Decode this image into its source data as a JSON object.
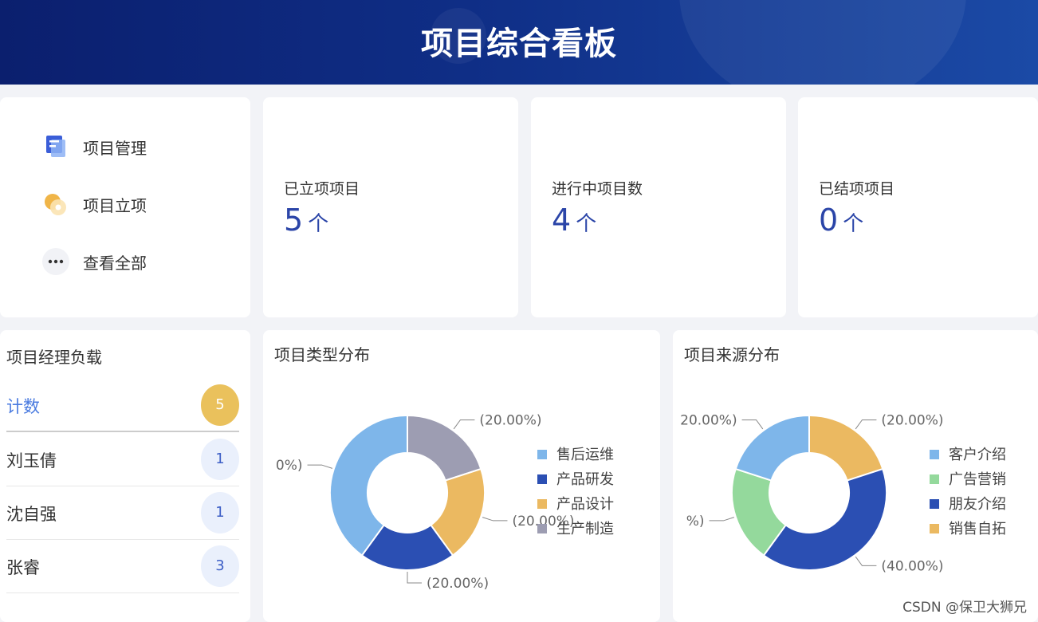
{
  "header": {
    "title": "项目综合看板"
  },
  "quick_links": [
    {
      "label": "项目管理",
      "icon": "project-manage-icon"
    },
    {
      "label": "项目立项",
      "icon": "project-setup-icon"
    },
    {
      "label": "查看全部",
      "icon": "more-dots-icon"
    }
  ],
  "stats": [
    {
      "label": "已立项项目",
      "value": "5",
      "unit": "个"
    },
    {
      "label": "进行中项目数",
      "value": "4",
      "unit": "个"
    },
    {
      "label": "已结项项目",
      "value": "0",
      "unit": "个"
    }
  ],
  "manager_load": {
    "title": "项目经理负载",
    "header": {
      "name": "计数",
      "count": "5"
    },
    "rows": [
      {
        "name": "刘玉倩",
        "count": "1"
      },
      {
        "name": "沈自强",
        "count": "1"
      },
      {
        "name": "张睿",
        "count": "3"
      }
    ]
  },
  "colors": {
    "light_blue": "#7eb6ea",
    "dark_blue": "#2b4fb3",
    "gold": "#ebb961",
    "gray": "#9d9db2",
    "green": "#94d99c"
  },
  "watermark": "CSDN @保卫大狮兄",
  "chart_data": [
    {
      "type": "pie",
      "title": "项目类型分布",
      "categories": [
        "售后运维",
        "产品研发",
        "产品设计",
        "生产制造"
      ],
      "values": [
        40,
        20,
        20,
        20
      ],
      "colors": [
        "#7eb6ea",
        "#2b4fb3",
        "#ebb961",
        "#9d9db2"
      ],
      "slice_order": [
        "生产制造",
        "产品设计",
        "产品研发",
        "售后运维"
      ],
      "labels": {
        "生产制造": "(20.00%)",
        "产品设计": "(20.00%)",
        "产品研发": "(20.00%)",
        "售后运维": "0%)"
      },
      "legend_position": "right"
    },
    {
      "type": "pie",
      "title": "项目来源分布",
      "categories": [
        "客户介绍",
        "广告营销",
        "朋友介绍",
        "销售自拓"
      ],
      "values": [
        20,
        20,
        40,
        20
      ],
      "colors": [
        "#7eb6ea",
        "#94d99c",
        "#2b4fb3",
        "#ebb961"
      ],
      "slice_order": [
        "销售自拓",
        "朋友介绍",
        "广告营销",
        "客户介绍"
      ],
      "labels": {
        "销售自拓": "(20.00%)",
        "朋友介绍": "(40.00%)",
        "广告营销": "%)",
        "客户介绍": "20.00%)"
      },
      "legend_position": "right"
    }
  ]
}
